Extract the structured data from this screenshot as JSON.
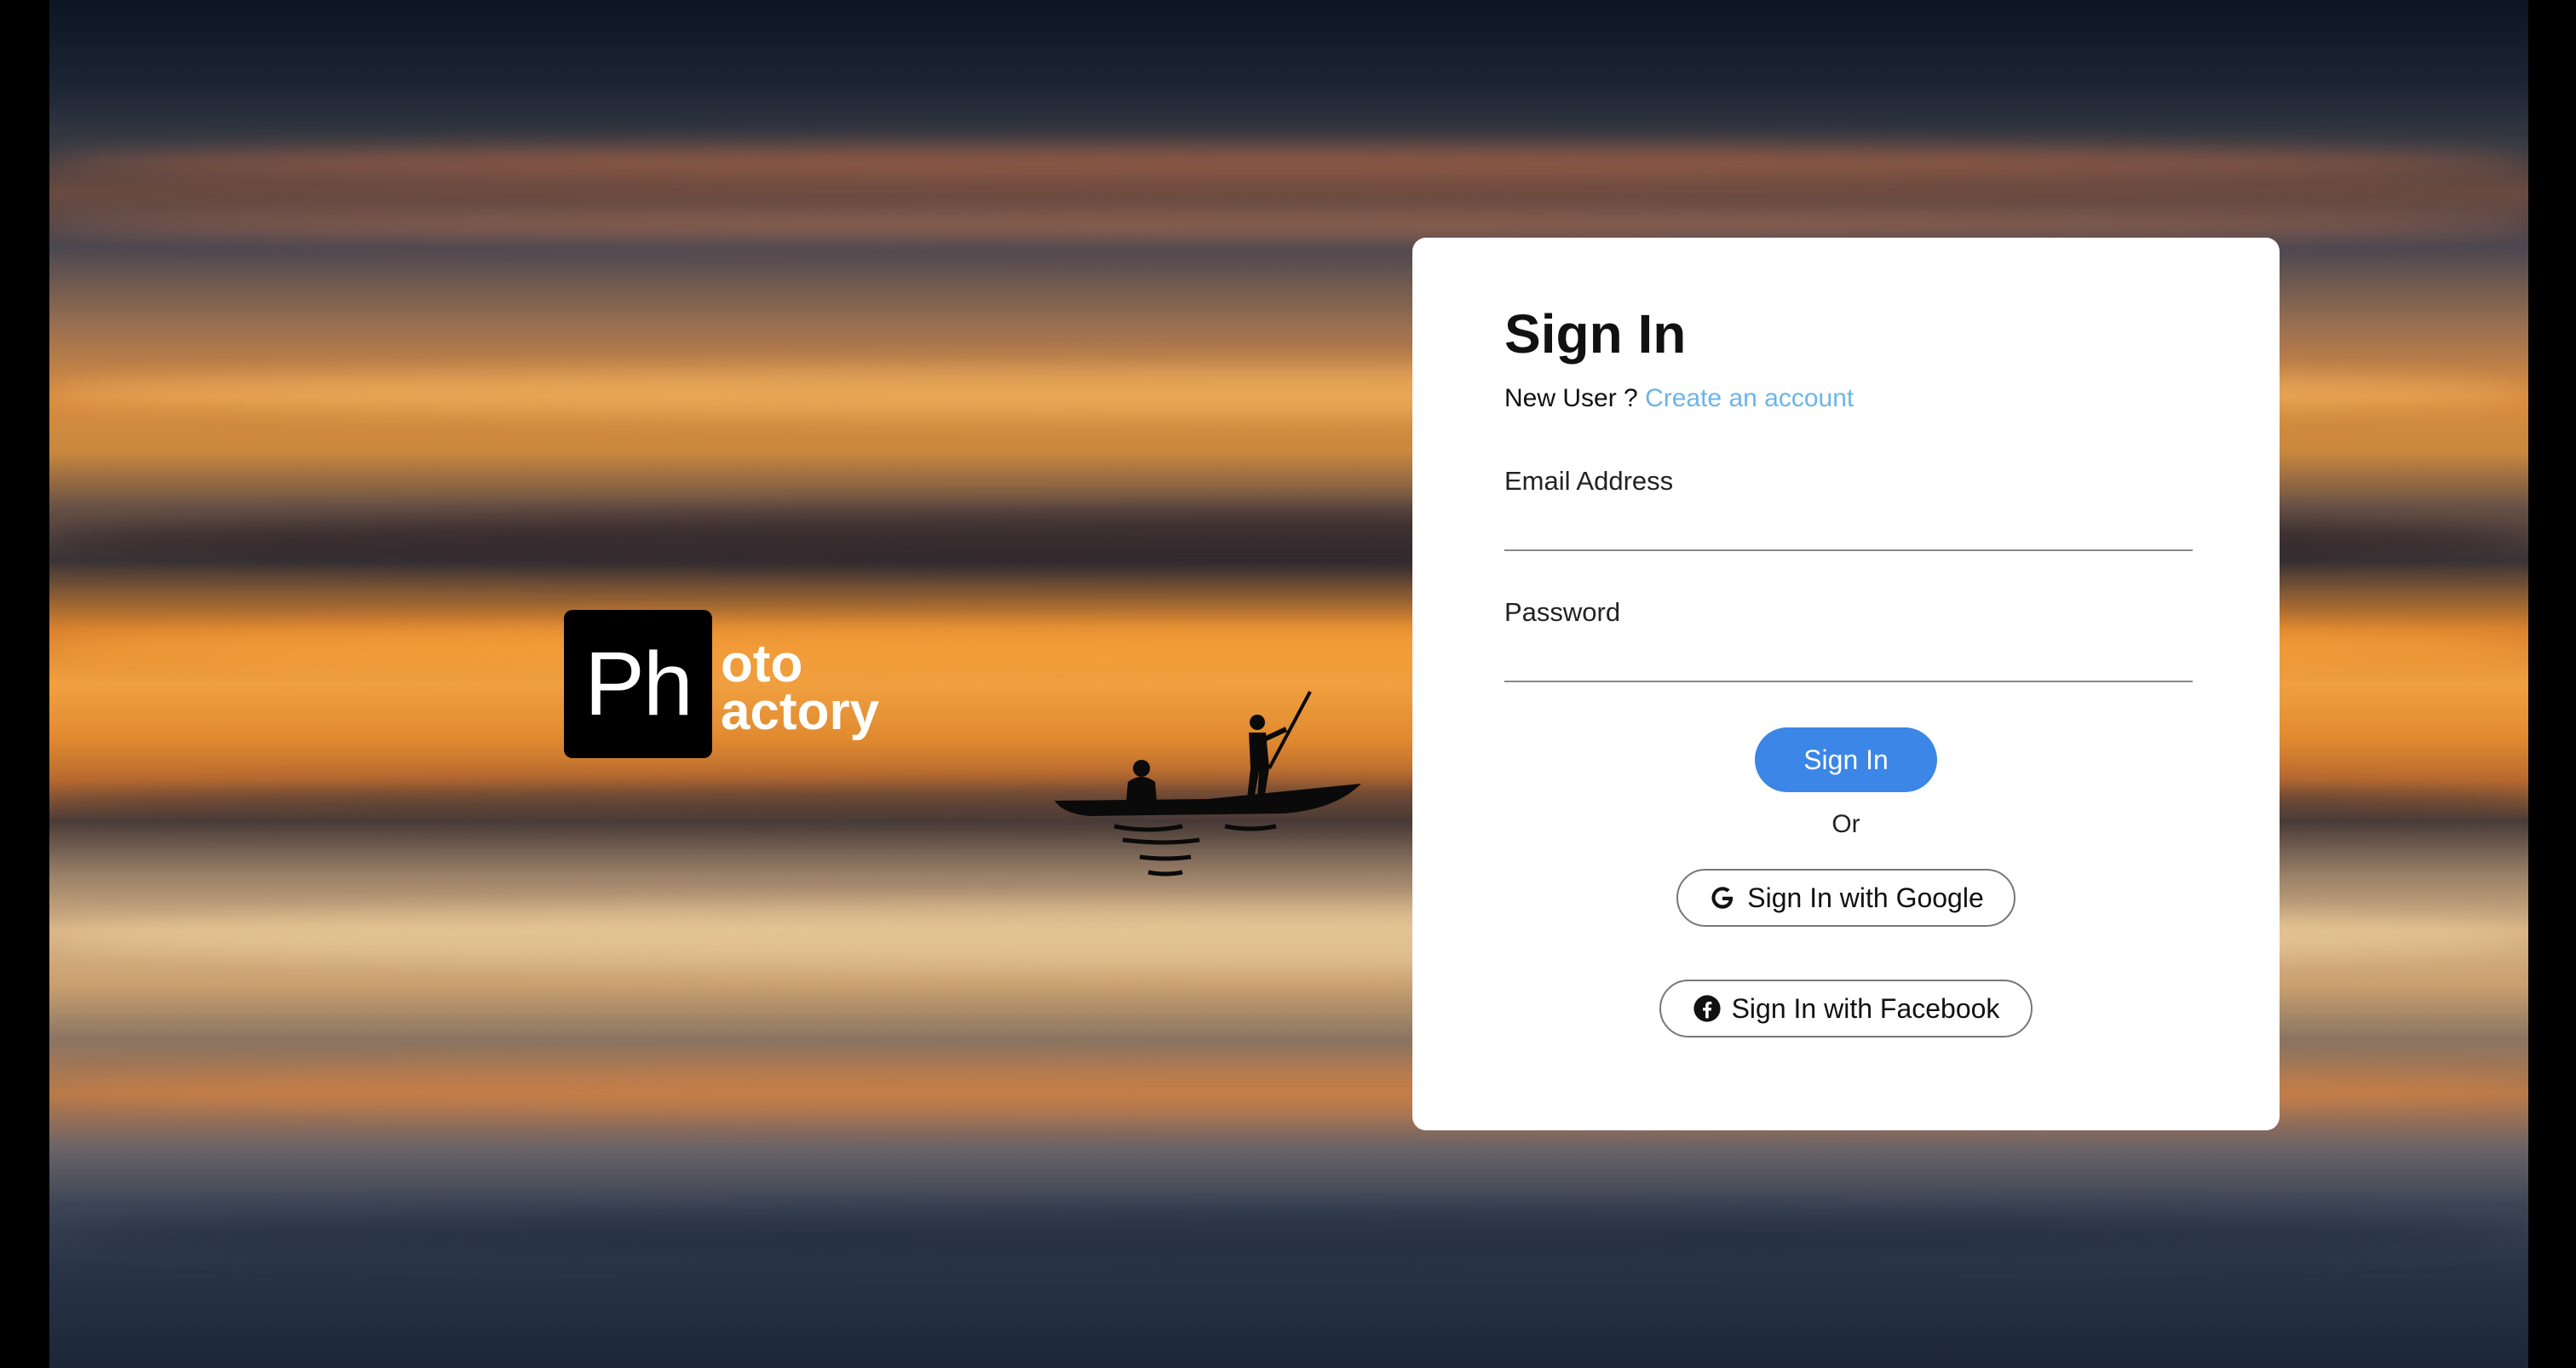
{
  "brand": {
    "logo_mark": "Ph",
    "logo_line1": "oto",
    "logo_line2": "actory"
  },
  "signin": {
    "title": "Sign In",
    "new_user_prefix": "New User ?",
    "create_account_link": "Create an account",
    "email_label": "Email Address",
    "email_value": "",
    "password_label": "Password",
    "password_value": "",
    "submit_label": "Sign In",
    "or_label": "Or",
    "google_label": "Sign In with Google",
    "facebook_label": "Sign In with Facebook"
  },
  "colors": {
    "primary_button": "#3b86e6",
    "link": "#6cb4e8",
    "card": "#ffffff"
  },
  "icons": {
    "google": "google-icon",
    "facebook": "facebook-icon"
  }
}
